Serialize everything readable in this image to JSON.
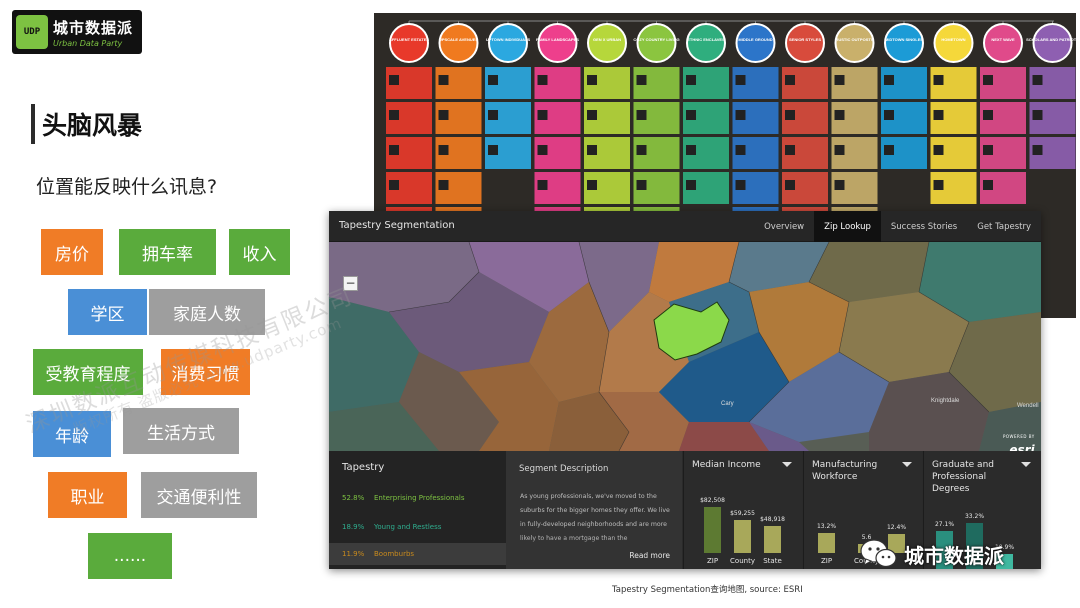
{
  "logo": {
    "cn": "城市数据派",
    "en": "Urban Data Party",
    "mark": "UDP"
  },
  "heading": "头脑风暴",
  "subtitle": "位置能反映什么讯息?",
  "tags": [
    {
      "label": "房价",
      "color": "#f07c26"
    },
    {
      "label": "拥车率",
      "color": "#5aab3c"
    },
    {
      "label": "收入",
      "color": "#5aab3c"
    },
    {
      "label": "学区",
      "color": "#4a8fd6"
    },
    {
      "label": "家庭人数",
      "color": "#9e9e9e"
    },
    {
      "label": "受教育程度",
      "color": "#5aab3c"
    },
    {
      "label": "消费习惯",
      "color": "#f07c26"
    },
    {
      "label": "年龄",
      "color": "#4a8fd6"
    },
    {
      "label": "生活方式",
      "color": "#9e9e9e"
    },
    {
      "label": "职业",
      "color": "#f07c26"
    },
    {
      "label": "交通便利性",
      "color": "#9e9e9e"
    },
    {
      "label": "......",
      "color": "#5aab3c"
    }
  ],
  "poster": {
    "groups": [
      "AFFLUENT ESTATES",
      "UPSCALE AVENUES",
      "UPTOWN INDIVIDUALS",
      "FAMILY LANDSCAPES",
      "GEN X URBAN",
      "COZY COUNTRY LIVING",
      "ETHNIC ENCLAVES",
      "MIDDLE GROUND",
      "SENIOR STYLES",
      "RUSTIC OUTPOSTS",
      "MIDTOWN SINGLES",
      "HOMETOWN",
      "NEXT WAVE",
      "SCHOLARS AND PATRIOTS"
    ]
  },
  "app": {
    "title": "Tapestry Segmentation",
    "nav": [
      "Overview",
      "Zip Lookup",
      "Success Stories",
      "Get Tapestry"
    ],
    "nav_active": "Zip Lookup",
    "zoom_out": "−",
    "map_labels": [
      "Cary",
      "Knightdale",
      "Wendell"
    ],
    "esri_powered": "POWERED BY",
    "esri": "esri",
    "tapestry": {
      "title": "Tapestry",
      "rows": [
        {
          "pct": "52.8%",
          "name": "Enterprising Professionals",
          "color": "#7dc242"
        },
        {
          "pct": "18.9%",
          "name": "Young and Restless",
          "color": "#2fae8f"
        },
        {
          "pct": "11.9%",
          "name": "Boomburbs",
          "color": "#c88a1d"
        }
      ]
    },
    "description": {
      "title": "Segment Description",
      "text": "As young professionals, we've moved to the suburbs for the bigger homes they offer. We live in fully-developed neighborhoods and are more likely to have a mortgage than the",
      "read_more": "Read more"
    },
    "charts": [
      {
        "title": "Median Income",
        "categories": [
          "ZIP",
          "County",
          "State"
        ],
        "values": [
          82508,
          59255,
          48918
        ],
        "labels": [
          "$82,508",
          "$59,255",
          "$48,918"
        ],
        "colors": [
          "#5d7a32",
          "#a8a85a",
          "#a8a85a"
        ]
      },
      {
        "title": "Manufacturing Workforce",
        "categories": [
          "ZIP",
          "County"
        ],
        "values": [
          13.2,
          5.6,
          12.4
        ],
        "labels": [
          "13.2%",
          "5.6",
          "12.4%"
        ],
        "colors": [
          "#a8a85a",
          "#a8a85a",
          "#a8a85a"
        ]
      },
      {
        "title": "Graduate and Professional Degrees",
        "categories": [],
        "values": [
          27.1,
          33.2,
          10.9
        ],
        "labels": [
          "27.1%",
          "33.2%",
          "10.9%"
        ],
        "colors": [
          "#2a8f7e",
          "#1f6b5f",
          "#3fb8a0"
        ]
      }
    ]
  },
  "caption": "Tapestry Segmentation查询地图, source: ESRI",
  "watermark": "深圳数派互动传媒科技有限公司",
  "watermark2": "版权所有 盗版必究 www.udparty.com",
  "badge": {
    "text": "城市数据派",
    "icon": "wechat-icon"
  }
}
